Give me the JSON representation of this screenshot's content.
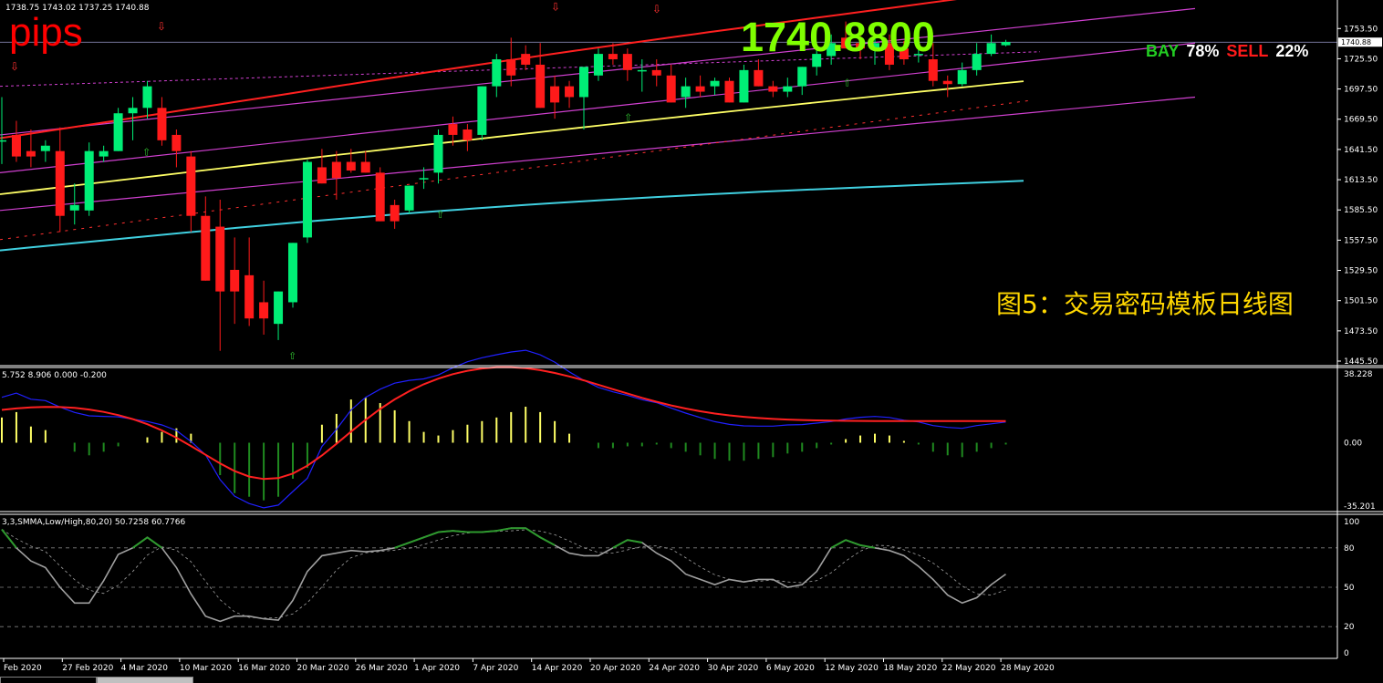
{
  "header": {
    "ohlc_text": "1738.75 1743.02 1737.25 1740.88",
    "pips_label": "pips",
    "big_price": "1740.8800",
    "bay_label": "BAY",
    "bay_pct": "78%",
    "sell_label": "SELL",
    "sell_pct": "22%",
    "caption": "图5：交易密码模板日线图",
    "current_price_tag": "1740.88"
  },
  "colors": {
    "bull": "#00ee76",
    "bear": "#ff1a1a",
    "ma_red": "#ff2020",
    "ma_yellow": "#ffff66",
    "ma_cyan": "#40d0e0",
    "channel": "#d040d0",
    "macd_pos": "#ffff66",
    "macd_neg": "#1f8a1f",
    "macd_signal": "#ff2020",
    "macd_line": "#2020ff",
    "stoch_main": "#a0a0a0",
    "stoch_overbought": "#2e9a2e",
    "stoch_oversold": "#ff2020"
  },
  "chart_data": [
    {
      "type": "candlestick",
      "title": "",
      "ylim": [
        1445.5,
        1774
      ],
      "y_ticks": [
        "1753.50",
        "1725.50",
        "1697.50",
        "1669.50",
        "1641.50",
        "1613.50",
        "1585.50",
        "1557.50",
        "1529.50",
        "1501.50",
        "1473.50",
        "1445.50"
      ],
      "x_ticks": [
        "Feb 2020",
        "27 Feb 2020",
        "4 Mar 2020",
        "10 Mar 2020",
        "16 Mar 2020",
        "20 Mar 2020",
        "26 Mar 2020",
        "1 Apr 2020",
        "7 Apr 2020",
        "14 Apr 2020",
        "20 Apr 2020",
        "24 Apr 2020",
        "30 Apr 2020",
        "6 May 2020",
        "12 May 2020",
        "18 May 2020",
        "22 May 2020",
        "28 May 2020"
      ],
      "candles": [
        {
          "o": 1650,
          "h": 1690,
          "l": 1628,
          "c": 1650
        },
        {
          "o": 1655,
          "h": 1668,
          "l": 1630,
          "c": 1635
        },
        {
          "o": 1640,
          "h": 1660,
          "l": 1625,
          "c": 1635
        },
        {
          "o": 1640,
          "h": 1650,
          "l": 1630,
          "c": 1645
        },
        {
          "o": 1640,
          "h": 1662,
          "l": 1565,
          "c": 1580
        },
        {
          "o": 1585,
          "h": 1610,
          "l": 1572,
          "c": 1590
        },
        {
          "o": 1585,
          "h": 1648,
          "l": 1580,
          "c": 1640
        },
        {
          "o": 1635,
          "h": 1645,
          "l": 1630,
          "c": 1640
        },
        {
          "o": 1640,
          "h": 1680,
          "l": 1640,
          "c": 1675
        },
        {
          "o": 1675,
          "h": 1690,
          "l": 1650,
          "c": 1680
        },
        {
          "o": 1680,
          "h": 1705,
          "l": 1670,
          "c": 1700
        },
        {
          "o": 1680,
          "h": 1690,
          "l": 1645,
          "c": 1650
        },
        {
          "o": 1655,
          "h": 1660,
          "l": 1625,
          "c": 1640
        },
        {
          "o": 1635,
          "h": 1640,
          "l": 1565,
          "c": 1580
        },
        {
          "o": 1580,
          "h": 1598,
          "l": 1548,
          "c": 1520
        },
        {
          "o": 1570,
          "h": 1595,
          "l": 1455,
          "c": 1510
        },
        {
          "o": 1530,
          "h": 1560,
          "l": 1480,
          "c": 1510
        },
        {
          "o": 1525,
          "h": 1560,
          "l": 1478,
          "c": 1485
        },
        {
          "o": 1500,
          "h": 1520,
          "l": 1470,
          "c": 1485
        },
        {
          "o": 1480,
          "h": 1510,
          "l": 1465,
          "c": 1510
        },
        {
          "o": 1500,
          "h": 1555,
          "l": 1495,
          "c": 1555
        },
        {
          "o": 1560,
          "h": 1632,
          "l": 1555,
          "c": 1630
        },
        {
          "o": 1625,
          "h": 1642,
          "l": 1610,
          "c": 1610
        },
        {
          "o": 1630,
          "h": 1640,
          "l": 1595,
          "c": 1615
        },
        {
          "o": 1630,
          "h": 1642,
          "l": 1620,
          "c": 1622
        },
        {
          "o": 1630,
          "h": 1640,
          "l": 1625,
          "c": 1620
        },
        {
          "o": 1620,
          "h": 1625,
          "l": 1575,
          "c": 1575
        },
        {
          "o": 1590,
          "h": 1595,
          "l": 1568,
          "c": 1575
        },
        {
          "o": 1585,
          "h": 1600,
          "l": 1582,
          "c": 1608
        },
        {
          "o": 1615,
          "h": 1625,
          "l": 1605,
          "c": 1615
        },
        {
          "o": 1620,
          "h": 1660,
          "l": 1610,
          "c": 1655
        },
        {
          "o": 1665,
          "h": 1672,
          "l": 1645,
          "c": 1655
        },
        {
          "o": 1660,
          "h": 1665,
          "l": 1640,
          "c": 1650
        },
        {
          "o": 1655,
          "h": 1700,
          "l": 1650,
          "c": 1700
        },
        {
          "o": 1700,
          "h": 1730,
          "l": 1690,
          "c": 1725
        },
        {
          "o": 1725,
          "h": 1745,
          "l": 1700,
          "c": 1710
        },
        {
          "o": 1730,
          "h": 1738,
          "l": 1715,
          "c": 1720
        },
        {
          "o": 1720,
          "h": 1740,
          "l": 1700,
          "c": 1680
        },
        {
          "o": 1700,
          "h": 1710,
          "l": 1670,
          "c": 1685
        },
        {
          "o": 1700,
          "h": 1705,
          "l": 1680,
          "c": 1690
        },
        {
          "o": 1690,
          "h": 1718,
          "l": 1660,
          "c": 1718
        },
        {
          "o": 1710,
          "h": 1735,
          "l": 1705,
          "c": 1730
        },
        {
          "o": 1730,
          "h": 1740,
          "l": 1720,
          "c": 1725
        },
        {
          "o": 1730,
          "h": 1735,
          "l": 1705,
          "c": 1715
        },
        {
          "o": 1715,
          "h": 1725,
          "l": 1695,
          "c": 1715
        },
        {
          "o": 1715,
          "h": 1725,
          "l": 1700,
          "c": 1710
        },
        {
          "o": 1710,
          "h": 1720,
          "l": 1685,
          "c": 1685
        },
        {
          "o": 1690,
          "h": 1708,
          "l": 1680,
          "c": 1700
        },
        {
          "o": 1700,
          "h": 1710,
          "l": 1690,
          "c": 1695
        },
        {
          "o": 1700,
          "h": 1708,
          "l": 1692,
          "c": 1705
        },
        {
          "o": 1705,
          "h": 1708,
          "l": 1685,
          "c": 1685
        },
        {
          "o": 1685,
          "h": 1720,
          "l": 1685,
          "c": 1715
        },
        {
          "o": 1715,
          "h": 1725,
          "l": 1700,
          "c": 1700
        },
        {
          "o": 1700,
          "h": 1705,
          "l": 1690,
          "c": 1695
        },
        {
          "o": 1695,
          "h": 1708,
          "l": 1690,
          "c": 1700
        },
        {
          "o": 1700,
          "h": 1718,
          "l": 1692,
          "c": 1718
        },
        {
          "o": 1718,
          "h": 1735,
          "l": 1710,
          "c": 1730
        },
        {
          "o": 1728,
          "h": 1748,
          "l": 1720,
          "c": 1740
        },
        {
          "o": 1745,
          "h": 1760,
          "l": 1735,
          "c": 1735
        },
        {
          "o": 1740,
          "h": 1752,
          "l": 1725,
          "c": 1735
        },
        {
          "o": 1735,
          "h": 1745,
          "l": 1720,
          "c": 1740
        },
        {
          "o": 1740,
          "h": 1748,
          "l": 1715,
          "c": 1720
        },
        {
          "o": 1735,
          "h": 1742,
          "l": 1720,
          "c": 1725
        },
        {
          "o": 1730,
          "h": 1738,
          "l": 1722,
          "c": 1730
        },
        {
          "o": 1725,
          "h": 1740,
          "l": 1700,
          "c": 1705
        },
        {
          "o": 1705,
          "h": 1710,
          "l": 1690,
          "c": 1702
        },
        {
          "o": 1702,
          "h": 1722,
          "l": 1700,
          "c": 1715
        },
        {
          "o": 1715,
          "h": 1740,
          "l": 1710,
          "c": 1730
        },
        {
          "o": 1730,
          "h": 1748,
          "l": 1728,
          "c": 1740
        },
        {
          "o": 1738,
          "h": 1743,
          "l": 1737,
          "c": 1741
        }
      ]
    },
    {
      "type": "line",
      "title": "",
      "ylim": [
        -35.201,
        38.228
      ],
      "y_ticks": [
        "38.228",
        "0.00",
        "-35.201"
      ]
    },
    {
      "type": "line",
      "title": "",
      "ylim": [
        0,
        100
      ],
      "y_ticks": [
        "100",
        "80",
        "50",
        "20",
        "0"
      ]
    }
  ],
  "labels": {
    "macd_title": "5.752 8.906 0.000 -0.200",
    "stoch_title": "3,3,SMMA,Low/High,80,20) 50.7258 60.7766"
  }
}
